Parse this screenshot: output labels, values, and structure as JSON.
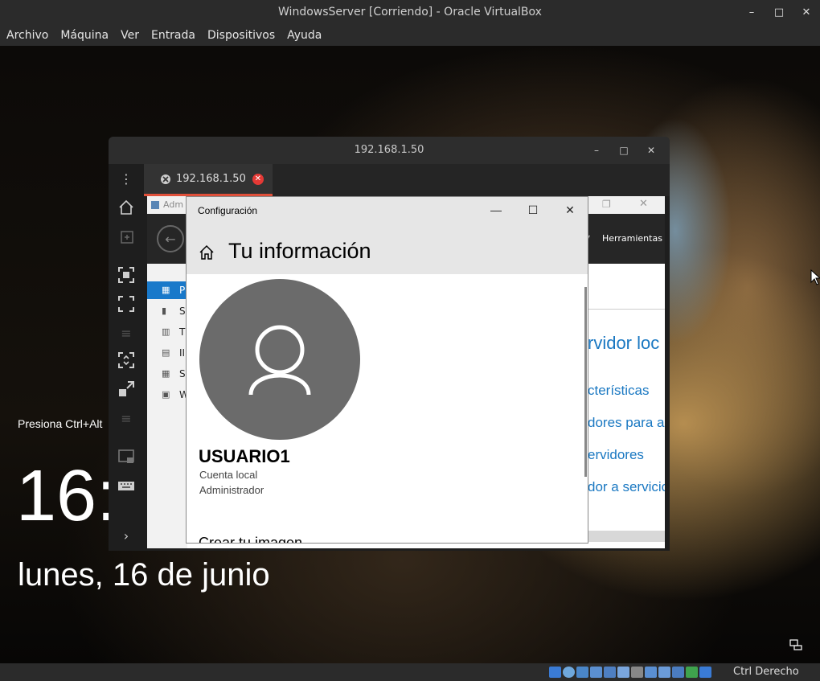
{
  "vbox": {
    "title": "WindowsServer [Corriendo] - Oracle VirtualBox",
    "menu": [
      "Archivo",
      "Máquina",
      "Ver",
      "Entrada",
      "Dispositivos",
      "Ayuda"
    ],
    "host_key": "Ctrl Derecho"
  },
  "lockscreen": {
    "hint": "Presiona Ctrl+Alt",
    "time": "16:(",
    "date": "lunes, 16 de junio"
  },
  "rdp": {
    "window_title": "192.168.1.50",
    "tab_label": "192.168.1.50"
  },
  "server_manager": {
    "title_partial": "Adm",
    "tools_label": "Herramientas",
    "nav_items": [
      "P",
      "S",
      "T",
      "II",
      "S",
      "W"
    ],
    "heading_partial": "rvidor loc",
    "links_partial": [
      "cterísticas",
      "dores para ac",
      "ervidores",
      "dor a servicio"
    ]
  },
  "settings": {
    "window_title": "Configuración",
    "page_heading": "Tu información",
    "username": "USUARIO1",
    "account_type": "Cuenta local",
    "role": "Administrador",
    "section_partial": "Crear tu imagen"
  },
  "colors": {
    "accent_blue": "#1979ca",
    "link_blue": "#1a78c2",
    "avatar_gray": "#6b6b6b",
    "tab_close_red": "#e53935"
  }
}
